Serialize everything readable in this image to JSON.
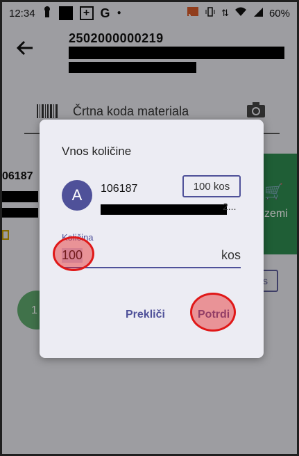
{
  "status_bar": {
    "time": "12:34",
    "battery": "60%",
    "icons": [
      "keyhole-icon",
      "black-square-icon",
      "plus-box-icon",
      "google-icon",
      "dot-icon",
      "cast-icon",
      "vibrate-icon",
      "data-icon",
      "wifi-icon",
      "battery-icon"
    ]
  },
  "header": {
    "back_icon": "arrow-left-icon",
    "document_code": "2502000000219"
  },
  "search": {
    "icon": "barcode-icon",
    "placeholder": "Črtna koda materiala",
    "camera_icon": "camera-icon"
  },
  "background": {
    "code": "06187",
    "card_label": "zemi",
    "side_button_label": "s",
    "avatar_text": "1"
  },
  "dialog": {
    "title": "Vnos količine",
    "avatar_letter": "A",
    "material_code": "106187",
    "material_ellipsis": "2...",
    "quantity_chip": "100 kos",
    "field_label": "Količina",
    "field_value": "100",
    "field_unit": "kos",
    "cancel_label": "Prekliči",
    "confirm_label": "Potrdi"
  },
  "colors": {
    "accent": "#4f5199",
    "success": "#2e8b50",
    "highlight": "#e01818"
  }
}
